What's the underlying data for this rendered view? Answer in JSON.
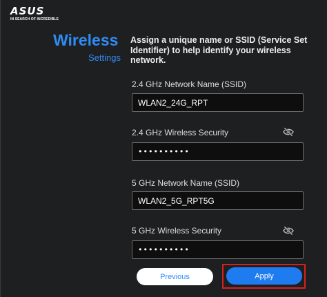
{
  "brand": {
    "logo_text": "ASUS",
    "tagline": "IN SEARCH OF INCREDIBLE"
  },
  "section": {
    "title": "Wireless",
    "subtitle": "Settings"
  },
  "description": "Assign a unique name or SSID (Service Set Identifier) to help identify your wireless network.",
  "fields": {
    "ssid_24": {
      "label": "2.4 GHz Network Name (SSID)",
      "value": "WLAN2_24G_RPT"
    },
    "sec_24": {
      "label": "2.4 GHz Wireless Security",
      "value": "••••••••••",
      "icon": "eye-slash-icon"
    },
    "ssid_5": {
      "label": "5 GHz Network Name (SSID)",
      "value": "WLAN2_5G_RPT5G"
    },
    "sec_5": {
      "label": "5 GHz Wireless Security",
      "value": "••••••••••",
      "icon": "eye-slash-icon"
    }
  },
  "buttons": {
    "previous": "Previous",
    "apply": "Apply"
  },
  "colors": {
    "accent": "#2f8cf5",
    "apply": "#1f7bf0",
    "highlight": "#d62020",
    "background": "#1e1f21"
  }
}
